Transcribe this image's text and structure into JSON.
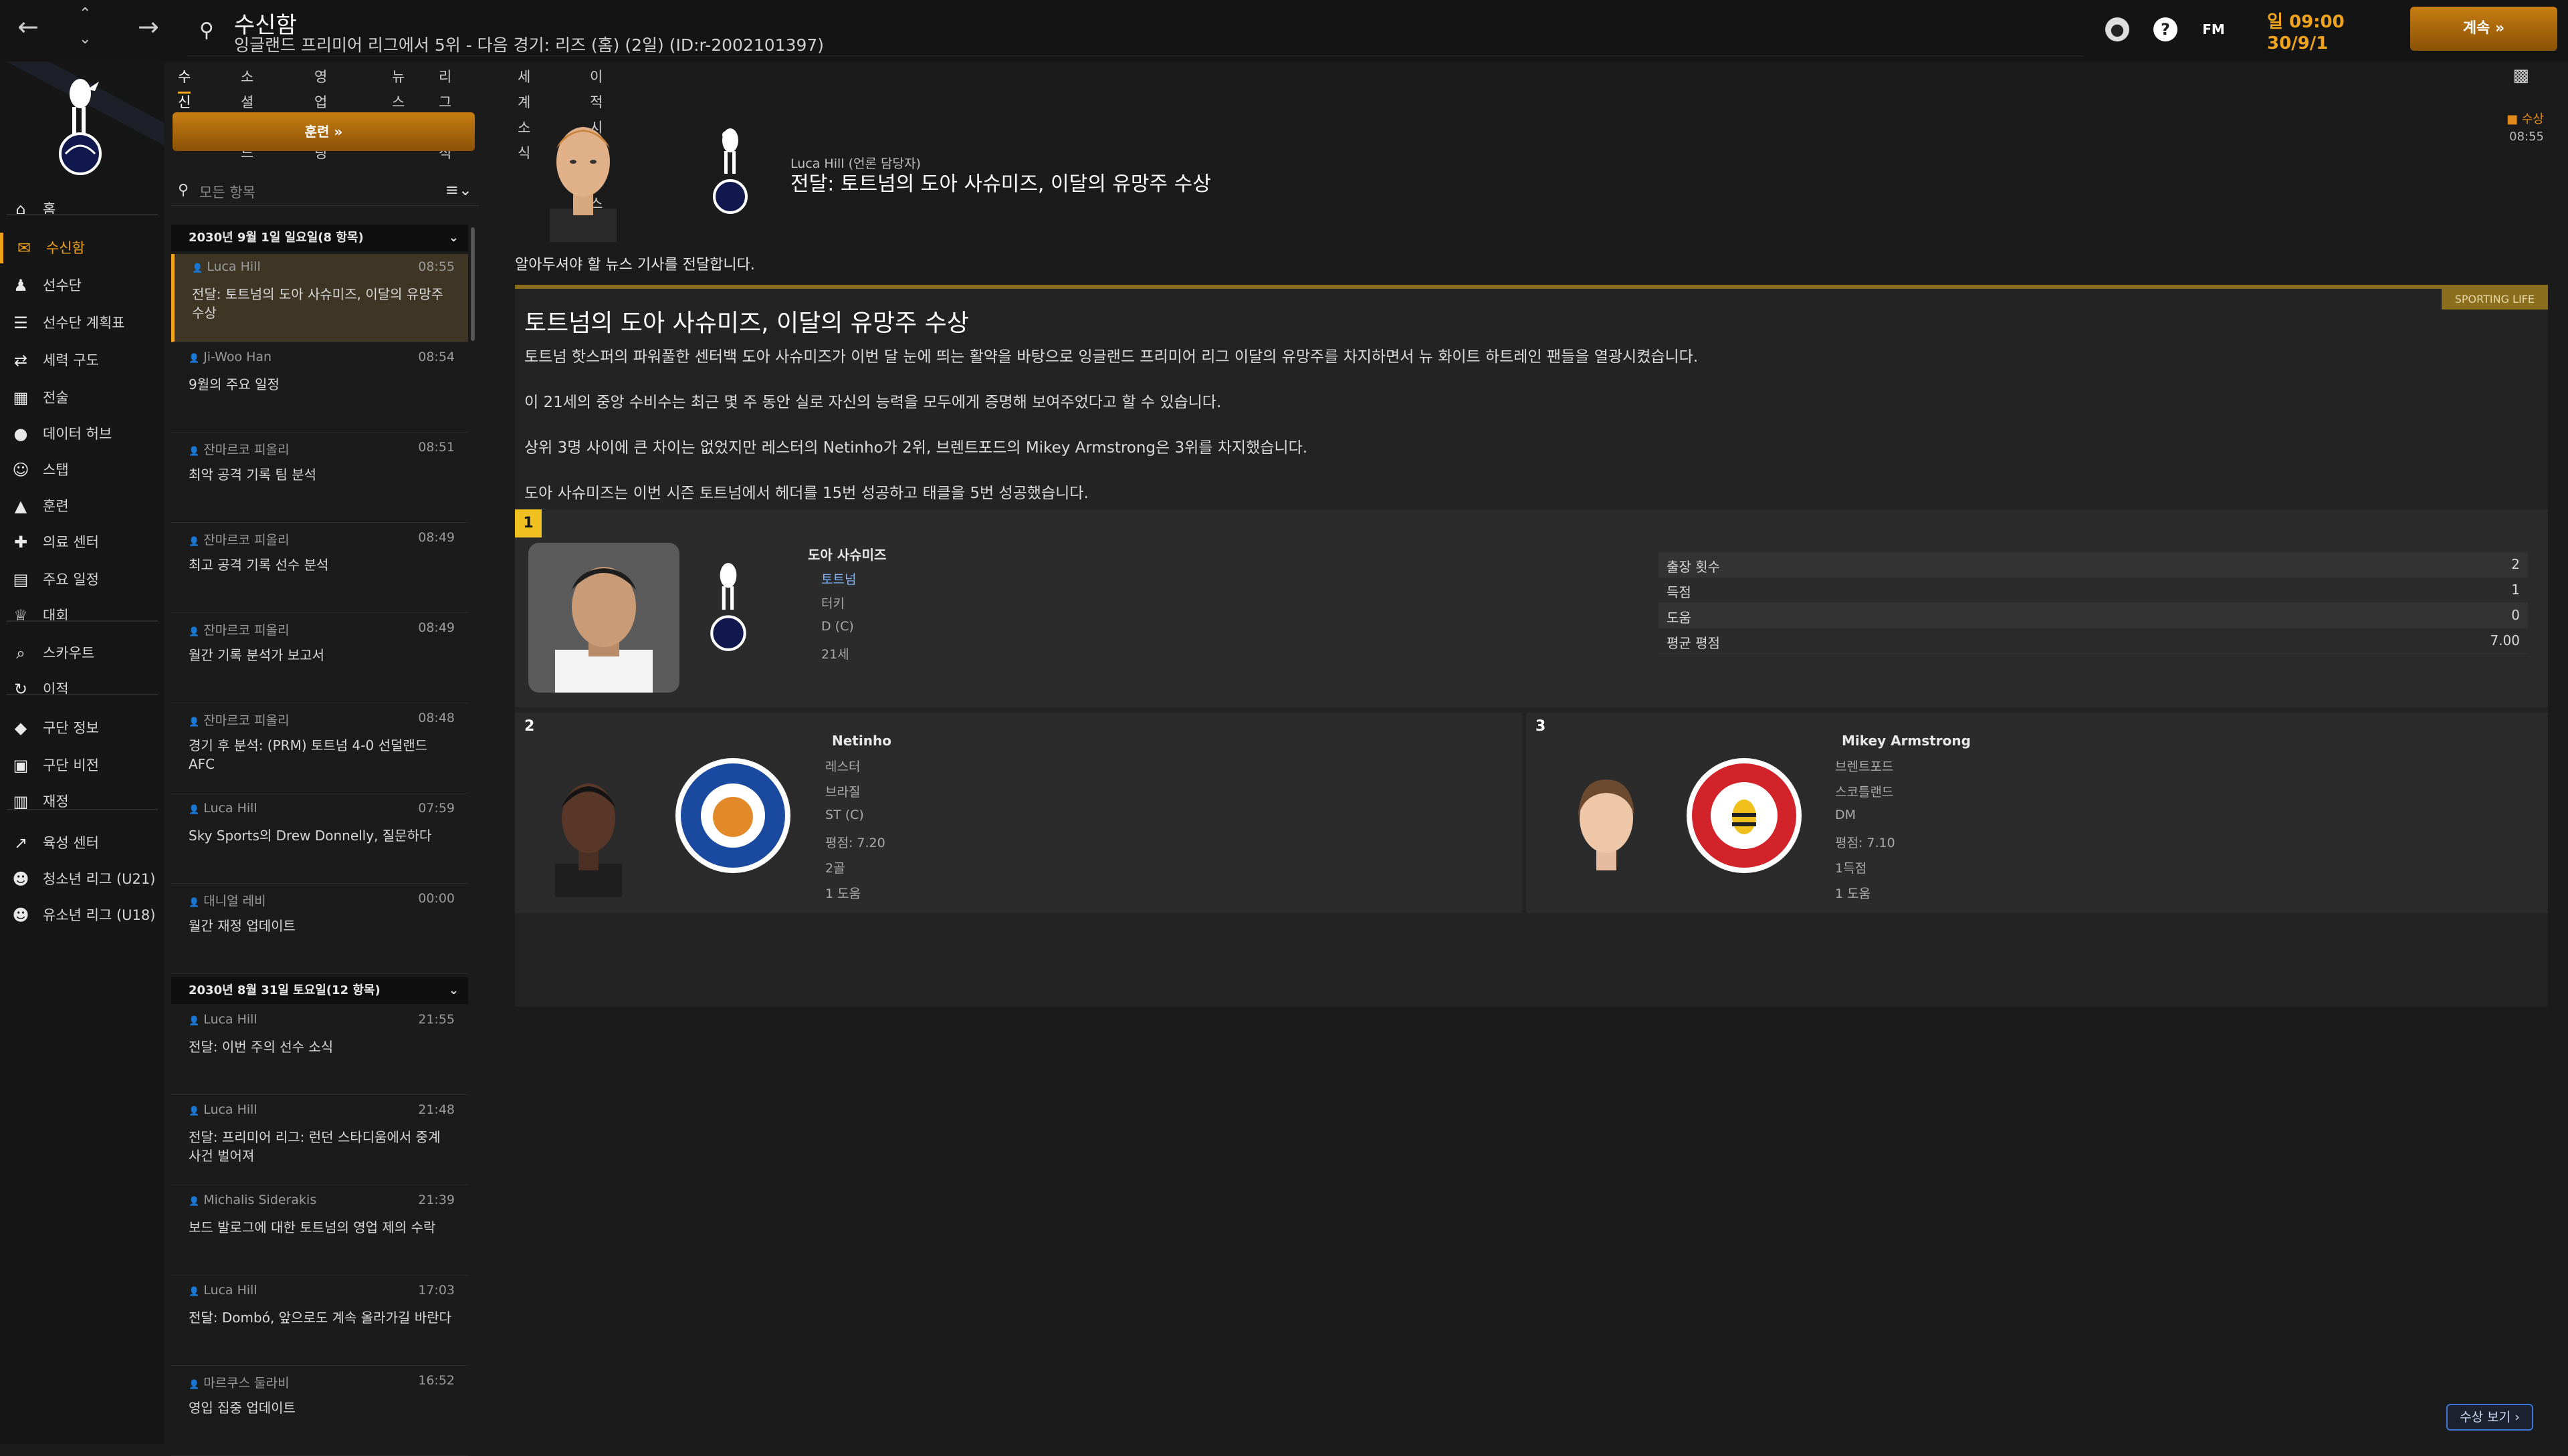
{
  "topbar": {
    "title": "수신함",
    "subtitle": "잉글랜드 프리미어 리그에서 5위 - 다음 경기: 리즈 (홈) (2일) (ID:r-2002101397)",
    "fm_label": "FM",
    "date_line1": "일 09:00",
    "date_line2": "30/9/1",
    "continue_label": "계속"
  },
  "nav": [
    {
      "label": "홈",
      "icon": "home-icon"
    },
    {
      "label": "수신함",
      "icon": "inbox-icon",
      "active": true
    },
    {
      "label": "선수단",
      "icon": "squad-icon"
    },
    {
      "label": "선수단 계획표",
      "icon": "plan-icon"
    },
    {
      "label": "세력 구도",
      "icon": "dynamics-icon"
    },
    {
      "label": "전술",
      "icon": "tactics-icon"
    },
    {
      "label": "데이터 허브",
      "icon": "data-icon"
    },
    {
      "label": "스탭",
      "icon": "staff-icon"
    },
    {
      "label": "훈련",
      "icon": "training-icon"
    },
    {
      "label": "의료 센터",
      "icon": "medical-icon"
    },
    {
      "label": "주요 일정",
      "icon": "calendar-icon"
    },
    {
      "label": "대회",
      "icon": "trophy-icon"
    },
    {
      "label": "스카우트",
      "icon": "scout-icon"
    },
    {
      "label": "이적",
      "icon": "transfer-icon"
    },
    {
      "label": "구단 정보",
      "icon": "club-info-icon"
    },
    {
      "label": "구단 비전",
      "icon": "vision-icon"
    },
    {
      "label": "재정",
      "icon": "finance-icon"
    },
    {
      "label": "육성 센터",
      "icon": "development-icon"
    },
    {
      "label": "청소년 리그 (U21)",
      "icon": "u21-icon"
    },
    {
      "label": "유소년 리그 (U18)",
      "icon": "u18-icon"
    }
  ],
  "tabs": [
    "수신함",
    "소셜 피드",
    "영업 미팅",
    "뉴스",
    "리그 소식",
    "세계 소식",
    "이적 시장 뉴스"
  ],
  "inbox": {
    "button_label": "훈련",
    "search_placeholder": "모든 항목",
    "group1": "2030년 9월 1일 일요일(8 항목)",
    "group2": "2030년 8월 31일 토요일(12 항목)",
    "messages1": [
      {
        "from": "Luca Hill",
        "time": "08:55",
        "subject": "전달: 토트넘의 도아 사슈미즈, 이달의 유망주 수상"
      },
      {
        "from": "Ji-Woo Han",
        "time": "08:54",
        "subject": "9월의 주요 일정"
      },
      {
        "from": "잔마르코 피올리",
        "time": "08:51",
        "subject": "최악 공격 기록 팀 분석"
      },
      {
        "from": "잔마르코 피올리",
        "time": "08:49",
        "subject": "최고 공격 기록 선수 분석"
      },
      {
        "from": "잔마르코 피올리",
        "time": "08:49",
        "subject": "월간 기록 분석가 보고서"
      },
      {
        "from": "잔마르코 피올리",
        "time": "08:48",
        "subject": "경기 후 분석: (PRM) 토트넘 4-0 선덜랜드 AFC"
      },
      {
        "from": "Luca Hill",
        "time": "07:59",
        "subject": "Sky Sports의 Drew Donnelly, 질문하다"
      },
      {
        "from": "대니얼 레비",
        "time": "00:00",
        "subject": "월간 재정 업데이트"
      }
    ],
    "messages2": [
      {
        "from": "Luca Hill",
        "time": "21:55",
        "subject": "전달: 이번 주의 선수 소식"
      },
      {
        "from": "Luca Hill",
        "time": "21:48",
        "subject": "전달: 프리미어 리그: 런던 스타디움에서 중계 사건 벌어져"
      },
      {
        "from": "Michalis Siderakis",
        "time": "21:39",
        "subject": "보드 발로그에 대한 토트넘의 영업 제의 수락"
      },
      {
        "from": "Luca Hill",
        "time": "17:03",
        "subject": "전달: Dombó, 앞으로도 계속 올라가길 바란다"
      },
      {
        "from": "마르쿠스 둘라비",
        "time": "16:52",
        "subject": "영입 집중 업데이트"
      }
    ]
  },
  "message": {
    "sender": "Luca Hill (언론 담당자)",
    "title": "전달: 토트넘의 도아 사슈미즈, 이달의 유망주 수상",
    "award_tag": "수상",
    "award_time": "08:55",
    "intro": "알아두셔야 할 뉴스 기사를 전달합니다.",
    "article_label": "SPORTING LIFE",
    "article_title": "토트넘의 도아 사슈미즈, 이달의 유망주 수상",
    "paragraphs": [
      "토트넘 핫스퍼의 파워풀한 센터백 도아 사슈미즈가 이번 달 눈에 띄는 활약을 바탕으로 잉글랜드 프리미어 리그 이달의 유망주를 차지하면서 뉴 화이트 하트레인 팬들을 열광시켰습니다.",
      "이 21세의 중앙 수비수는 최근 몇 주 동안 실로 자신의 능력을 모두에게 증명해 보여주었다고 할 수 있습니다.",
      "상위 3명 사이에 큰 차이는 없었지만 레스터의 Netinho가 2위, 브렌트포드의 Mikey Armstrong은 3위를 차지했습니다.",
      "도아 사슈미즈는 이번 시즌 토트넘에서 헤더를 15번 성공하고 태클을 5번 성공했습니다."
    ],
    "first": {
      "rank": "1",
      "name": "도아 사슈미즈",
      "club": "토트넘",
      "nation": "터키",
      "position": "D (C)",
      "age": "21세",
      "stats": [
        {
          "k": "출장 횟수",
          "v": "2"
        },
        {
          "k": "득점",
          "v": "1"
        },
        {
          "k": "도움",
          "v": "0"
        },
        {
          "k": "평균 평점",
          "v": "7.00"
        }
      ]
    },
    "second": {
      "rank": "2",
      "name": "Netinho",
      "club": "레스터",
      "nation": "브라질",
      "position": "ST (C)",
      "rating": "평점: 7.20",
      "goals": "2골",
      "assists": "1 도움"
    },
    "third": {
      "rank": "3",
      "name": "Mikey Armstrong",
      "club": "브렌트포드",
      "nation": "스코틀랜드",
      "position": "DM",
      "rating": "평점: 7.10",
      "goals": "1득점",
      "assists": "1 도움"
    },
    "view_awards": "수상 보기"
  },
  "colors": {
    "accent": "#f0a31c",
    "background": "#1b1b1c",
    "panel": "#232324",
    "leicester": "#1a4aa0",
    "brentford": "#d2232a"
  }
}
